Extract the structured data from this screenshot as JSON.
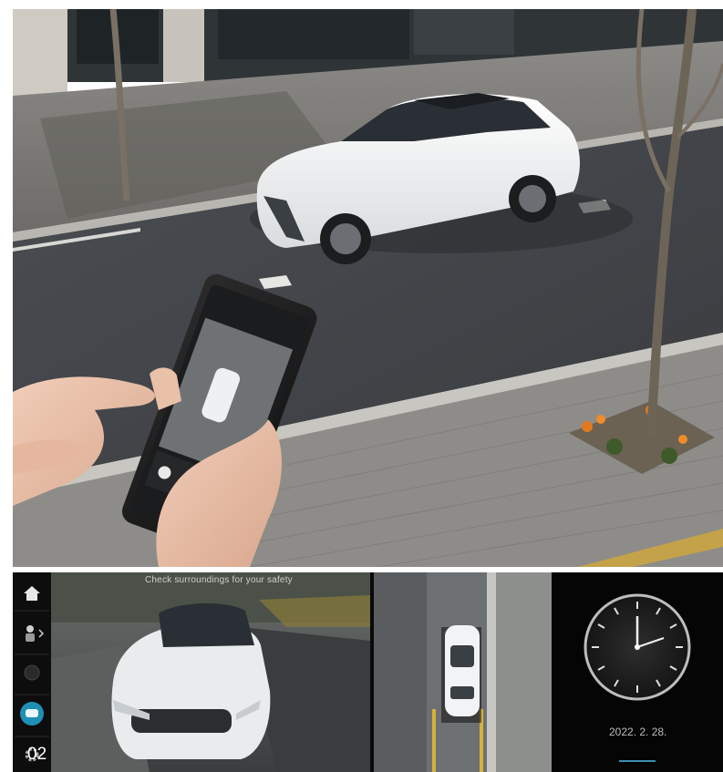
{
  "bottom_screen": {
    "hint_text": "Check surroundings for your safety",
    "clock_date": "2022. 2. 28.",
    "image_number": "02"
  },
  "icons": [
    "home-icon",
    "remote-parking-icon",
    "settings-icon",
    "car-view-icon",
    "gear-icon"
  ]
}
